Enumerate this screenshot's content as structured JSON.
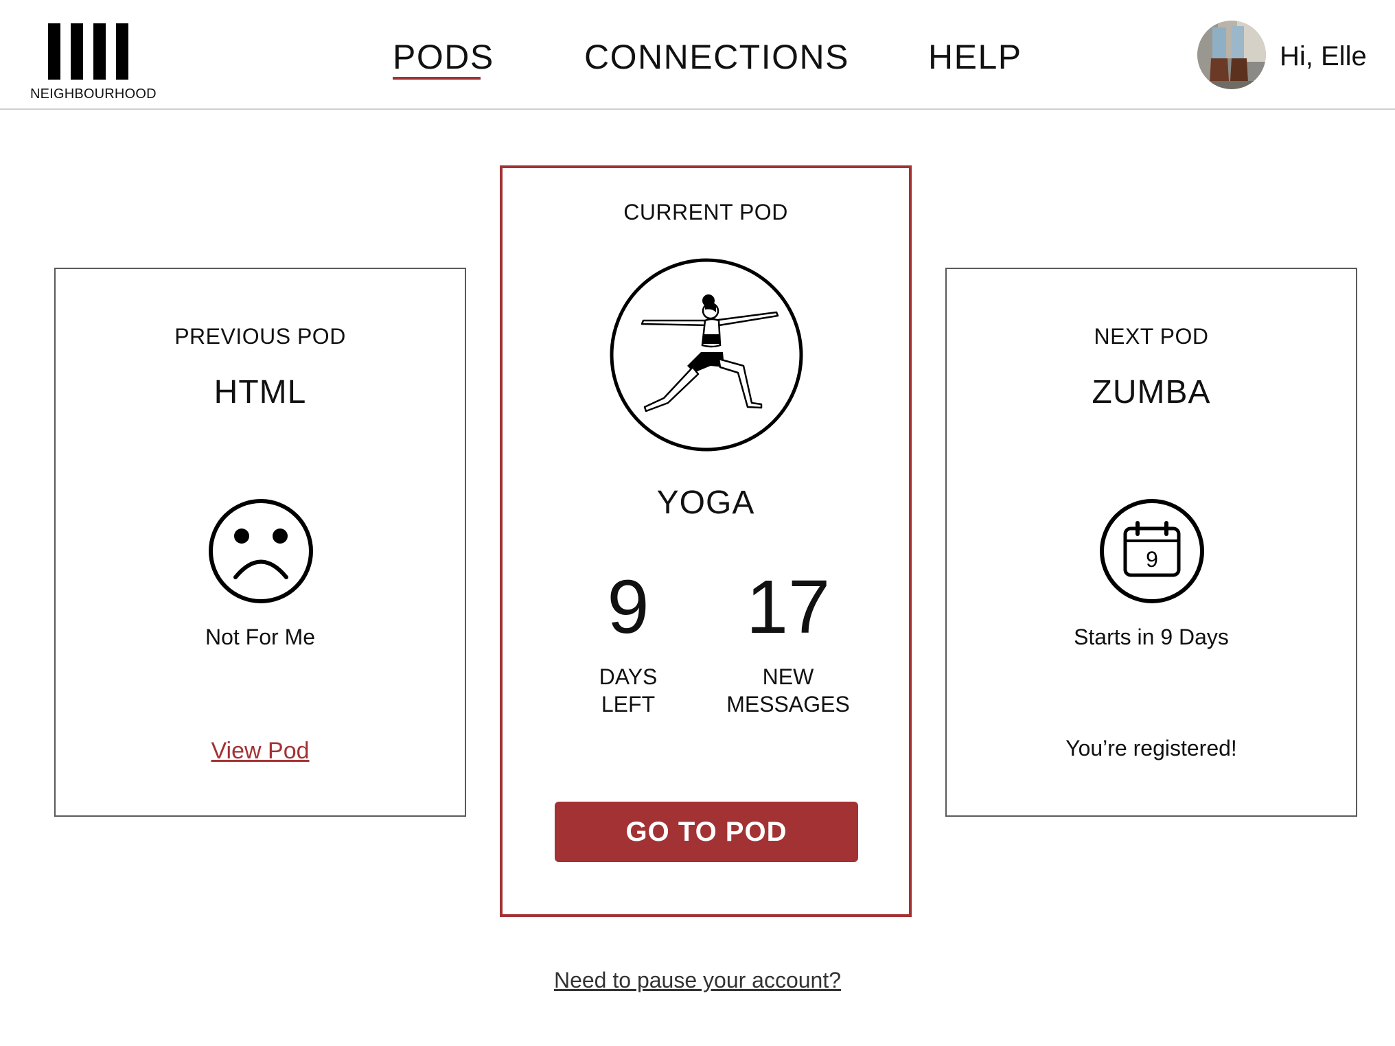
{
  "header": {
    "logo_text": "NEIGHBOURHOOD",
    "nav": [
      {
        "label": "PODS",
        "active": true
      },
      {
        "label": "CONNECTIONS",
        "active": false
      },
      {
        "label": "HELP",
        "active": false
      }
    ],
    "greeting": "Hi, Elle"
  },
  "cards": {
    "previous": {
      "label": "PREVIOUS POD",
      "title": "HTML",
      "icon": "sad-face-icon",
      "status": "Not For Me",
      "link": "View Pod"
    },
    "current": {
      "label": "CURRENT POD",
      "icon": "yoga-pose-icon",
      "title": "YOGA",
      "days_left": "9",
      "days_left_label_1": "DAYS",
      "days_left_label_2": "LEFT",
      "new_messages": "17",
      "new_messages_label_1": "NEW",
      "new_messages_label_2": "MESSAGES",
      "button": "GO TO POD"
    },
    "next": {
      "label": "NEXT POD",
      "title": "ZUMBA",
      "icon": "calendar-icon",
      "calendar_day": "9",
      "status": "Starts in 9 Days",
      "note": "You’re registered!"
    }
  },
  "footer": {
    "pause_link": "Need to pause your account?"
  },
  "colors": {
    "accent": "#a33234",
    "border": "#5a5a5a",
    "text": "#111111"
  }
}
